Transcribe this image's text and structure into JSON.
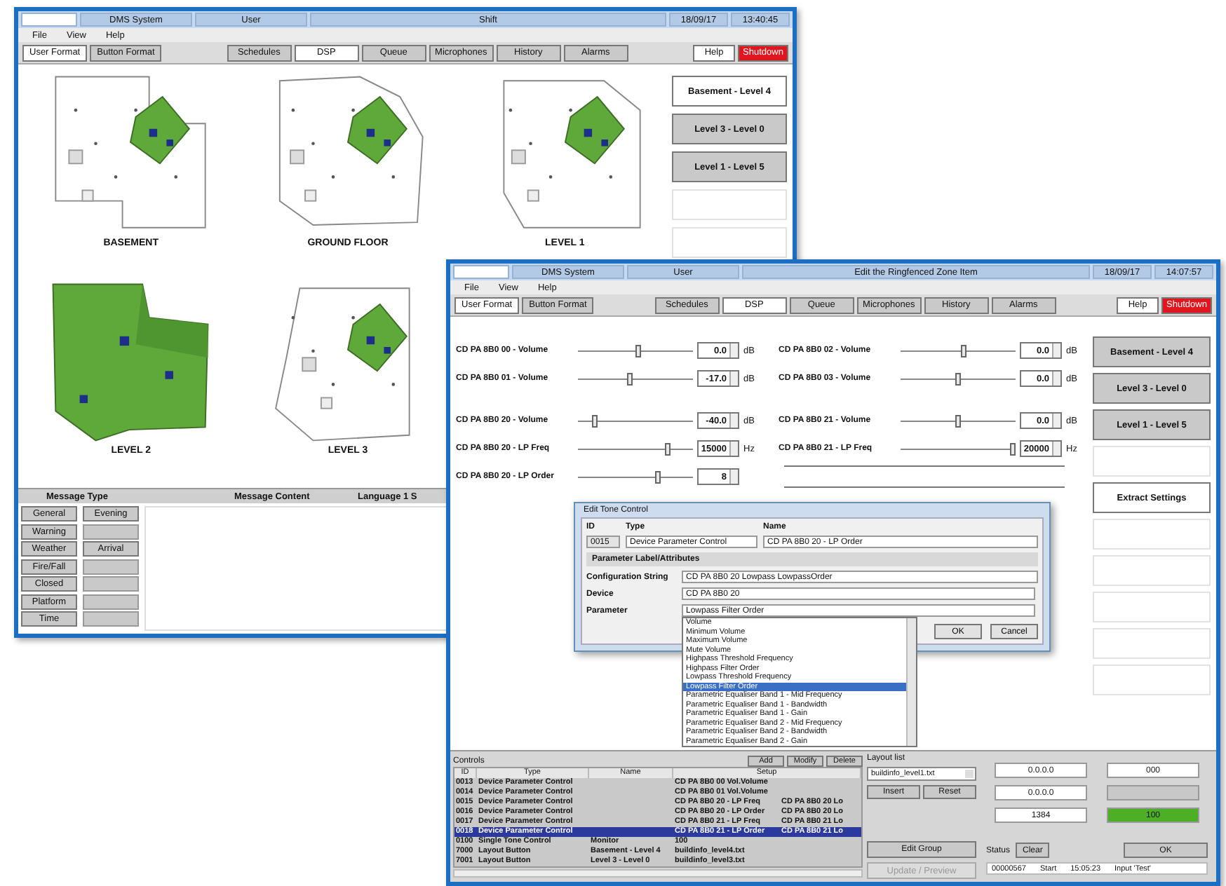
{
  "windows": [
    {
      "kind": "floorplans",
      "title_bar": [
        "DMS System",
        "User",
        "Shift",
        "18/09/17",
        "13:40:45"
      ],
      "menu": [
        "File",
        "View",
        "Help"
      ],
      "format_tabs": [
        {
          "label": "User Format",
          "selected": true
        },
        {
          "label": "Button Format",
          "selected": false
        }
      ],
      "tabs": [
        {
          "label": "Schedules",
          "selected": false
        },
        {
          "label": "DSP",
          "selected": true
        },
        {
          "label": "Queue",
          "selected": false
        },
        {
          "label": "Microphones",
          "selected": false
        },
        {
          "label": "History",
          "selected": false
        },
        {
          "label": "Alarms",
          "selected": false
        }
      ],
      "help_button": "Help",
      "shutdown_button": "Shutdown",
      "floors": [
        {
          "label": "BASEMENT",
          "kind": "partial"
        },
        {
          "label": "GROUND FLOOR",
          "kind": "partial"
        },
        {
          "label": "LEVEL 1",
          "kind": "partial"
        },
        {
          "label": "LEVEL 2",
          "kind": "full"
        },
        {
          "label": "LEVEL 3",
          "kind": "partial"
        }
      ],
      "zone_buttons": [
        {
          "kind": "button",
          "label": "Basement - Level 4",
          "selected": true
        },
        {
          "kind": "button",
          "label": "Level 3 - Level 0",
          "selected": false
        },
        {
          "kind": "button",
          "label": "Level 1 - Level 5",
          "selected": false
        },
        {
          "kind": "blank"
        },
        {
          "kind": "blank"
        }
      ],
      "message_panel": {
        "headers": [
          "Message Type",
          "Message Content",
          "Language 1 S"
        ],
        "type_buttons": [
          {
            "kind": "button",
            "label": "General"
          },
          {
            "kind": "button",
            "label": "Warning"
          },
          {
            "kind": "button",
            "label": "Weather"
          },
          {
            "kind": "button",
            "label": "Fire/Fall"
          },
          {
            "kind": "button",
            "label": "Closed"
          },
          {
            "kind": "button",
            "label": "Platform"
          },
          {
            "kind": "button",
            "label": "Time"
          }
        ],
        "extra_buttons": [
          {
            "kind": "button",
            "label": "Evening"
          },
          {
            "kind": "blank"
          },
          {
            "kind": "button",
            "label": "Arrival"
          },
          {
            "kind": "blank"
          },
          {
            "kind": "blank"
          },
          {
            "kind": "blank"
          },
          {
            "kind": "blank"
          }
        ]
      }
    },
    {
      "kind": "dsp",
      "title_bar": [
        "DMS System",
        "User",
        "Edit the Ringfenced Zone Item",
        "18/09/17",
        "14:07:57"
      ],
      "menu": [
        "File",
        "View",
        "Help"
      ],
      "format_tabs": [
        {
          "label": "User Format",
          "selected": true
        },
        {
          "label": "Button Format",
          "selected": false
        }
      ],
      "tabs": [
        {
          "label": "Schedules",
          "selected": false
        },
        {
          "label": "DSP",
          "selected": true
        },
        {
          "label": "Queue",
          "selected": false
        },
        {
          "label": "Microphones",
          "selected": false
        },
        {
          "label": "History",
          "selected": false
        },
        {
          "label": "Alarms",
          "selected": false
        }
      ],
      "help_button": "Help",
      "shutdown_button": "Shutdown",
      "slider_groups": [
        {
          "left": [
            {
              "kind": "slider",
              "label": "CD PA 8B0 00 - Volume",
              "level": 0.52,
              "value": "0.0",
              "unit": "dB"
            },
            {
              "kind": "slider",
              "label": "CD PA 8B0 01 - Volume",
              "level": 0.45,
              "value": "-17.0",
              "unit": "dB"
            }
          ],
          "right": [
            {
              "kind": "slider",
              "label": "CD PA 8B0 02 - Volume",
              "level": 0.55,
              "value": "0.0",
              "unit": "dB"
            },
            {
              "kind": "slider",
              "label": "CD PA 8B0 03 - Volume",
              "level": 0.5,
              "value": "0.0",
              "unit": "dB"
            }
          ]
        },
        {
          "left": [
            {
              "kind": "slider",
              "label": "CD PA 8B0 20 - Volume",
              "level": 0.15,
              "value": "-40.0",
              "unit": "dB"
            },
            {
              "kind": "slider",
              "label": "CD PA 8B0 20 - LP Freq",
              "level": 0.78,
              "value": "15000",
              "unit": "Hz"
            },
            {
              "kind": "slider",
              "label": "CD PA 8B0 20 - LP Order",
              "level": 0.7,
              "value": "8"
            }
          ],
          "right": [
            {
              "kind": "slider",
              "label": "CD PA 8B0 21 - Volume",
              "level": 0.5,
              "value": "0.0",
              "unit": "dB"
            },
            {
              "kind": "slider",
              "label": "CD PA 8B0 21 - LP Freq",
              "level": 0.97,
              "value": "20000",
              "unit": "Hz"
            },
            {
              "kind": "blank"
            }
          ]
        }
      ],
      "side_buttons": [
        {
          "kind": "button",
          "label": "Basement - Level 4",
          "selected": false
        },
        {
          "kind": "button",
          "label": "Level 3 - Level 0",
          "selected": false
        },
        {
          "kind": "button",
          "label": "Level 1 - Level 5",
          "selected": false
        },
        {
          "kind": "blank"
        },
        {
          "kind": "button",
          "label": "Extract Settings",
          "selected": true
        },
        {
          "kind": "blank"
        },
        {
          "kind": "blank"
        },
        {
          "kind": "blank"
        },
        {
          "kind": "blank"
        },
        {
          "kind": "blank"
        }
      ],
      "dialog": {
        "title": "Edit Tone Control",
        "id_label": "ID",
        "type_label": "Type",
        "name_label": "Name",
        "id": "0015",
        "type": "Device Parameter Control",
        "name": "CD PA 8B0 20 - LP Order",
        "section": "Parameter Label/Attributes",
        "config_label": "Configuration String",
        "config": "CD PA 8B0 20 Lowpass LowpassOrder",
        "device_label": "Device",
        "device": "CD PA 8B0 20",
        "parameter_label": "Parameter",
        "parameter": "Lowpass Filter Order",
        "ok": "OK",
        "cancel": "Cancel",
        "options": [
          {
            "label": "Volume",
            "selected": false
          },
          {
            "label": "Minimum Volume",
            "selected": false
          },
          {
            "label": "Maximum Volume",
            "selected": false
          },
          {
            "label": "Mute Volume",
            "selected": false
          },
          {
            "label": "Highpass Threshold Frequency",
            "selected": false
          },
          {
            "label": "Highpass Filter Order",
            "selected": false
          },
          {
            "label": "Lowpass Threshold Frequency",
            "selected": false
          },
          {
            "label": "Lowpass Filter Order",
            "selected": true
          },
          {
            "label": "Parametric Equaliser Band 1 - Mid Frequency",
            "selected": false
          },
          {
            "label": "Parametric Equaliser Band 1 - Bandwidth",
            "selected": false
          },
          {
            "label": "Parametric Equaliser Band 1 - Gain",
            "selected": false
          },
          {
            "label": "Parametric Equaliser Band 2 - Mid Frequency",
            "selected": false
          },
          {
            "label": "Parametric Equaliser Band 2 - Bandwidth",
            "selected": false
          },
          {
            "label": "Parametric Equaliser Band 2 - Gain",
            "selected": false
          }
        ]
      },
      "controls": {
        "label": "Controls",
        "buttons": [
          "Add",
          "Modify",
          "Delete"
        ],
        "columns": [
          "ID",
          "Type",
          "Name",
          "Setup"
        ],
        "rows": [
          {
            "cells": [
              "0013",
              "Device Parameter Control",
              "",
              "CD PA 8B0 00 Vol.Volume",
              ""
            ],
            "selected": false
          },
          {
            "cells": [
              "0014",
              "Device Parameter Control",
              "",
              "CD PA 8B0 01 Vol.Volume",
              ""
            ],
            "selected": false
          },
          {
            "cells": [
              "0015",
              "Device Parameter Control",
              "",
              "CD PA 8B0 20 - LP Freq",
              "CD PA 8B0 20 Lo"
            ],
            "selected": false
          },
          {
            "cells": [
              "0016",
              "Device Parameter Control",
              "",
              "CD PA 8B0 20 - LP Order",
              "CD PA 8B0 20 Lo"
            ],
            "selected": false
          },
          {
            "cells": [
              "0017",
              "Device Parameter Control",
              "",
              "CD PA 8B0 21 - LP Freq",
              "CD PA 8B0 21 Lo"
            ],
            "selected": false
          },
          {
            "cells": [
              "0018",
              "Device Parameter Control",
              "",
              "CD PA 8B0 21 - LP Order",
              "CD PA 8B0 21 Lo"
            ],
            "selected": true
          },
          {
            "cells": [
              "0100",
              "Single Tone Control",
              "Monitor",
              "100",
              ""
            ],
            "selected": false
          },
          {
            "cells": [
              "7000",
              "Layout Button",
              "Basement - Level 4",
              "buildinfo_level4.txt",
              ""
            ],
            "selected": false
          },
          {
            "cells": [
              "7001",
              "Layout Button",
              "Level 3 - Level 0",
              "buildinfo_level3.txt",
              ""
            ],
            "selected": false
          }
        ]
      },
      "layout": {
        "label": "Layout list",
        "value": "buildinfo_level1.txt",
        "buttons": [
          "Insert",
          "Reset"
        ],
        "edit_group": "Edit Group",
        "update": {
          "label": "Update / Preview",
          "disabled": true
        }
      },
      "readouts": [
        {
          "kind": "field",
          "value": "0.0.0.0"
        },
        {
          "kind": "field",
          "value": "000"
        },
        {
          "kind": "field",
          "value": "0.0.0.0"
        },
        {
          "kind": "blank"
        },
        {
          "kind": "field",
          "value": "1384"
        },
        {
          "kind": "meter",
          "level": 1,
          "reading": "100"
        }
      ],
      "status": {
        "label": "Status",
        "clear": "Clear",
        "ok": "OK",
        "message_parts": [
          "00000567",
          "Start",
          "15:05:23",
          "Input 'Test'"
        ]
      }
    }
  ]
}
